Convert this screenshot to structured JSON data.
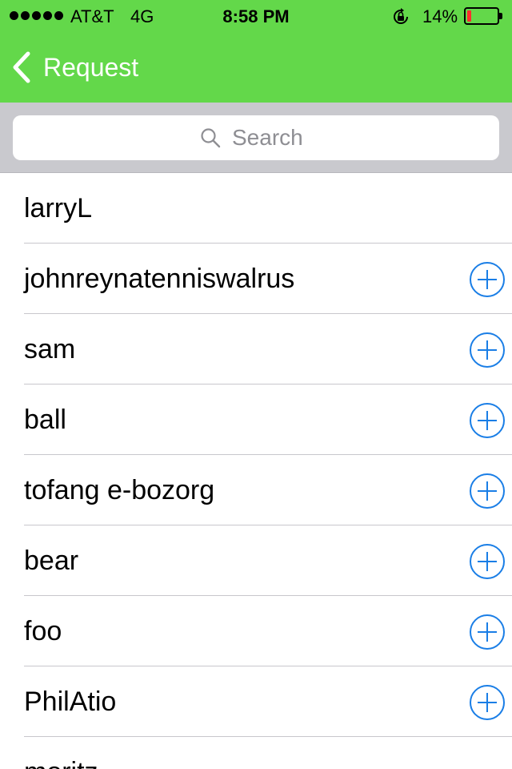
{
  "status_bar": {
    "carrier": "AT&T",
    "network": "4G",
    "time": "8:58 PM",
    "battery_percent": "14%",
    "battery_level": 0.14,
    "battery_color": "#ff2d2d",
    "icons": [
      "signal-dots-icon",
      "rotation-lock-icon",
      "battery-icon"
    ]
  },
  "nav": {
    "back_label": "Request",
    "back_icon": "chevron-left-icon",
    "background_color": "#63d84a"
  },
  "search": {
    "placeholder": "Search",
    "value": "",
    "icon": "search-icon"
  },
  "list": {
    "add_icon": "plus-circle-icon",
    "accent_color": "#1a7ee6",
    "items": [
      {
        "name": "larryL",
        "has_add": false
      },
      {
        "name": "johnreynatenniswalrus",
        "has_add": true
      },
      {
        "name": "sam",
        "has_add": true
      },
      {
        "name": "ball",
        "has_add": true
      },
      {
        "name": "tofang e-bozorg",
        "has_add": true
      },
      {
        "name": "bear",
        "has_add": true
      },
      {
        "name": "foo",
        "has_add": true
      },
      {
        "name": "PhilAtio",
        "has_add": true
      },
      {
        "name": "moritz",
        "has_add": false
      }
    ]
  }
}
